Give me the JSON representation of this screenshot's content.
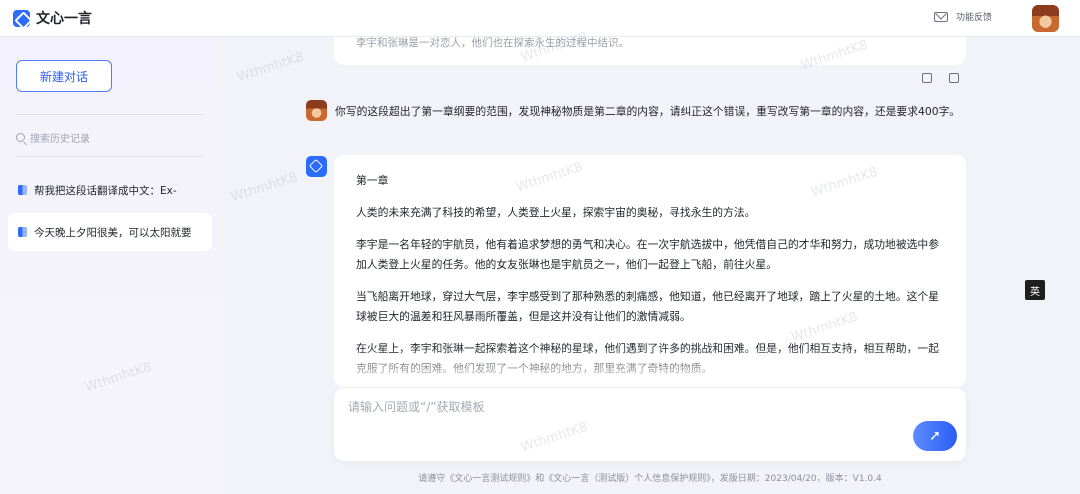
{
  "app": {
    "title": "文心一言"
  },
  "header": {
    "feedback_label": "功能反馈"
  },
  "sidebar": {
    "new_chat_label": "新建对话",
    "search_placeholder": "搜索历史记录",
    "history": [
      {
        "label": "帮我把这段话翻译成中文：Ex-",
        "active": false
      },
      {
        "label": "今天晚上夕阳很美，可以太阳就要",
        "active": true
      }
    ]
  },
  "conversation": {
    "previous_reply_tail": "李宇和张琳是一对恋人，他们也在探索永生的过程中结识。",
    "user_message": "你写的这段超出了第一章纲要的范围，发现神秘物质是第二章的内容，请纠正这个错误，重写改写第一章的内容，还是要求400字。",
    "reply_paragraphs": [
      "第一章",
      "人类的未来充满了科技的希望，人类登上火星，探索宇宙的奥秘，寻找永生的方法。",
      "李宇是一名年轻的宇航员，他有着追求梦想的勇气和决心。在一次宇航选拔中，他凭借自己的才华和努力，成功地被选中参加人类登上火星的任务。他的女友张琳也是宇航员之一，他们一起登上飞船，前往火星。",
      "当飞船离开地球，穿过大气层，李宇感受到了那种熟悉的刺痛感，他知道，他已经离开了地球，踏上了火星的土地。这个星球被巨大的温差和狂风暴雨所覆盖，但是这并没有让他们的激情减弱。",
      "在火星上，李宇和张琳一起探索着这个神秘的星球，他们遇到了许多的挑战和困难。但是，他们相互支持，相互帮助，一起克服了所有的困难。他们发现了一个神秘的地方，那里充满了奇特的物质。"
    ]
  },
  "input": {
    "placeholder": "请输入问题或“/”获取模板"
  },
  "footer": {
    "text": "请遵守《文心一言测试规则》和《文心一言（测试版）个人信息保护规则》，发版日期：2023/04/20，版本：V1.0.4"
  },
  "lang_badge": "英",
  "watermark": "WthmhtK8",
  "icons": {
    "logo": "wenxin-logo-icon",
    "feedback": "mail-icon",
    "search": "search-icon",
    "history": "chat-icon",
    "like": "thumbs-up-icon",
    "dislike": "thumbs-down-icon",
    "send": "send-icon"
  },
  "colors": {
    "accent": "#2b6bff",
    "sidebar_bg": "#f3f1fb",
    "main_bg": "#f2f3f8"
  }
}
